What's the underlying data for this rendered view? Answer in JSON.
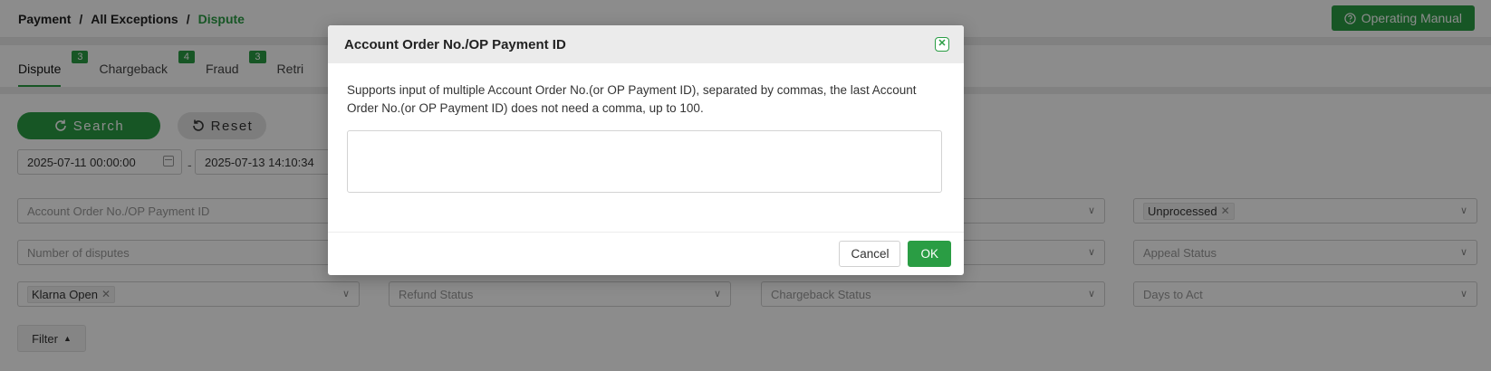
{
  "breadcrumb": {
    "items": [
      "Payment",
      "All Exceptions",
      "Dispute"
    ],
    "separator": "/"
  },
  "header": {
    "manual_button": "Operating Manual",
    "manual_icon": "help-circle-icon"
  },
  "tabs": [
    {
      "label": "Dispute",
      "count": "3",
      "active": true
    },
    {
      "label": "Chargeback",
      "count": "4"
    },
    {
      "label": "Fraud",
      "count": "3"
    },
    {
      "label": "Retri"
    }
  ],
  "actions": {
    "search": "Search",
    "reset": "Reset",
    "filter": "Filter"
  },
  "date_range": {
    "start": "2025-07-11 00:00:00",
    "end": "2025-07-13 14:10:34",
    "separator": "-"
  },
  "fields": {
    "account_order_placeholder": "Account Order No./OP Payment ID",
    "number_of_disputes_placeholder": "Number of disputes",
    "processing_status_tag": "Unprocessed",
    "appeal_status_placeholder": "Appeal Status",
    "merchant_tag": "Klarna Open",
    "refund_status_placeholder": "Refund Status",
    "chargeback_status_placeholder": "Chargeback Status",
    "days_to_act_placeholder": "Days to Act"
  },
  "modal": {
    "title": "Account Order No./OP Payment ID",
    "description": "Supports input of multiple Account Order No.(or OP Payment ID), separated by commas, the last Account Order No.(or OP Payment ID) does not need a comma, up to 100.",
    "textarea_value": "",
    "cancel": "Cancel",
    "ok": "OK"
  },
  "colors": {
    "accent": "#2a9d44",
    "overlay": "rgba(0,0,0,0.45)"
  }
}
